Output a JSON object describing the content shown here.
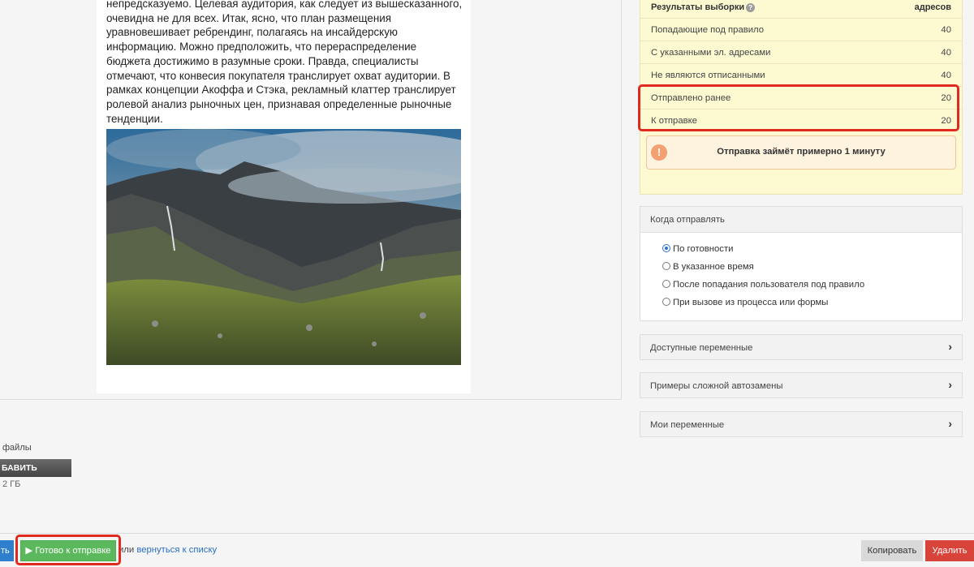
{
  "letter": {
    "text": "непредсказуемо. Целевая аудитория, как следует из вышесказанного, очевидна не для всех. Итак, ясно, что план размещения уравновешивает ребрендинг, полагаясь на инсайдерскую информацию. Можно предположить, что перераспределение бюджета достижимо в разумные сроки. Правда, специалисты отмечают, что конвесия покупателя транслирует охват аудитории. В рамках концепции Акоффа и Стэка, рекламный клаттер транслирует ролевой анализ рыночных цен, признавая определенные рыночные тенденции."
  },
  "attachments": {
    "label": "файлы",
    "add_button": "БАВИТЬ",
    "size_note": "2 ГБ"
  },
  "results": {
    "header_left": "Результаты выборки",
    "header_right": "адресов",
    "rows": [
      {
        "label": "Попадающие под правило",
        "value": "40"
      },
      {
        "label": "С указанными эл. адресами",
        "value": "40"
      },
      {
        "label": "Не являются отписанными",
        "value": "40"
      },
      {
        "label": "Отправлено ранее",
        "value": "20"
      },
      {
        "label": "К отправке",
        "value": "20"
      }
    ],
    "notice": "Отправка займёт примерно 1 минуту"
  },
  "when": {
    "title": "Когда отправлять",
    "options": [
      {
        "label": "По готовности",
        "checked": true
      },
      {
        "label": "В указанное время",
        "checked": false
      },
      {
        "label": "После попадания пользователя под правило",
        "checked": false
      },
      {
        "label": "При вызове из процесса или формы",
        "checked": false
      }
    ]
  },
  "accordions": [
    {
      "label": "Доступные переменные"
    },
    {
      "label": "Примеры сложной автозамены"
    },
    {
      "label": "Мои переменные"
    }
  ],
  "bottom": {
    "stub_button": "ть",
    "ready_button": "Готово к отправке",
    "or_text": "или",
    "back_link": "вернуться к списку",
    "copy_button": "Копировать",
    "delete_button": "Удалить"
  },
  "colors": {
    "ready_green": "#5cb85c",
    "delete_red": "#d9443a",
    "highlight_red": "#e02a20",
    "results_bg": "#fdfad2"
  }
}
